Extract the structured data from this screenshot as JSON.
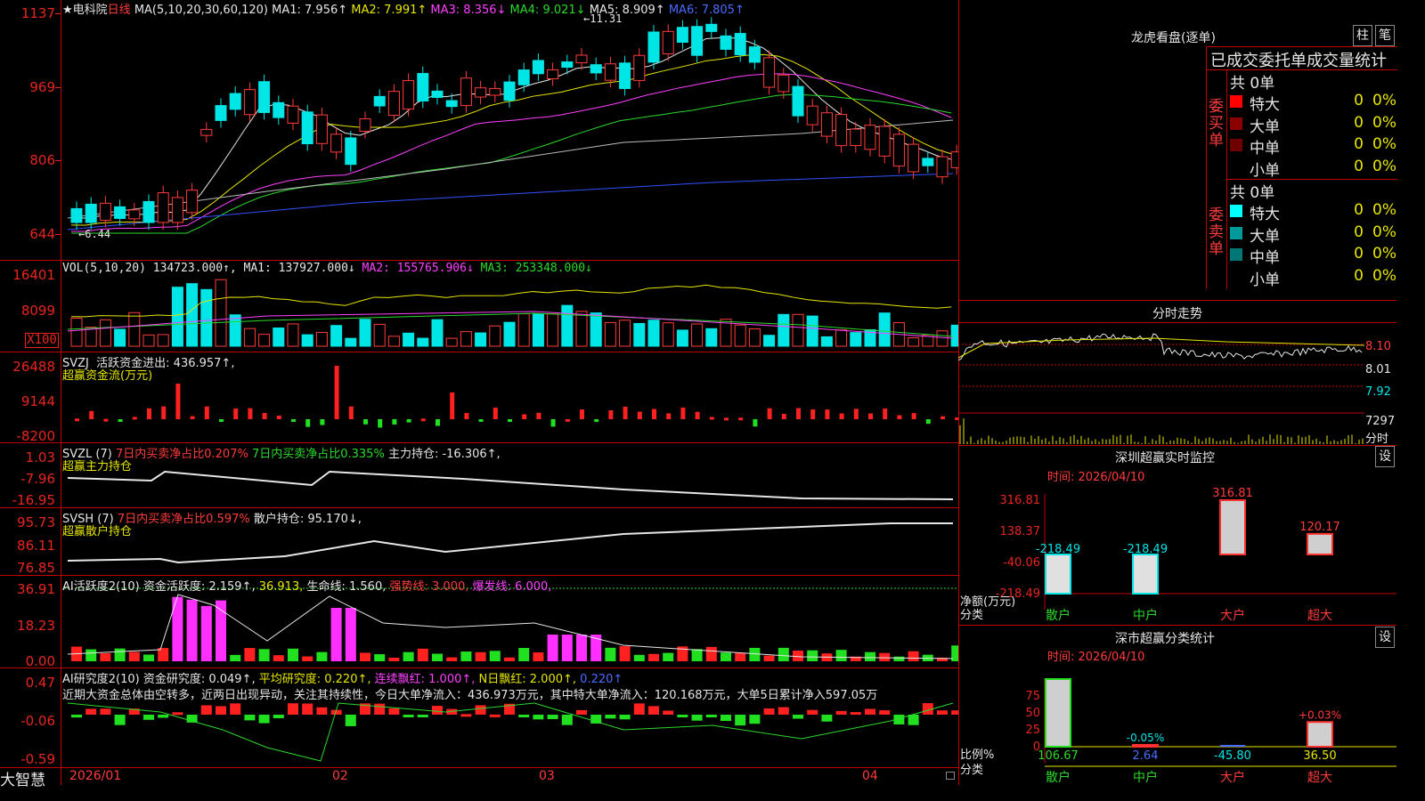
{
  "stock": {
    "name_label": "★电科院",
    "period": "日线",
    "ma_params": "MA(5,10,20,30,60,120)",
    "ma": [
      {
        "label": "MA1:",
        "value": "7.956↑",
        "color": "#e6e6e6"
      },
      {
        "label": "MA2:",
        "value": "7.991↑",
        "color": "#e6e600"
      },
      {
        "label": "MA3:",
        "value": "8.356↓",
        "color": "#ff40ff"
      },
      {
        "label": "MA4:",
        "value": "9.021↓",
        "color": "#2bd92b"
      },
      {
        "label": "MA5:",
        "value": "8.909↑",
        "color": "#e6e6e6"
      },
      {
        "label": "MA6:",
        "value": "7.805↑",
        "color": "#4a6bff"
      }
    ],
    "high_mark": "11.31",
    "low_mark": "6.44",
    "price_axis": [
      "1137",
      "969",
      "806",
      "644"
    ]
  },
  "vol": {
    "title": "VOL(5,10,20)",
    "value": "134723.000↑,",
    "ma": [
      {
        "label": "MA1:",
        "value": "137927.000↓",
        "color": "#e6e6e6"
      },
      {
        "label": "MA2:",
        "value": "155765.906↓",
        "color": "#ff40ff"
      },
      {
        "label": "MA3:",
        "value": "253348.000↓",
        "color": "#2bd92b"
      }
    ],
    "axis": [
      "16401",
      "8099"
    ],
    "unit": "X100"
  },
  "svzj": {
    "title": "SVZJ",
    "line1": "活跃资金进出: 436.957↑,",
    "line2": "超赢资金流(万元)",
    "axis": [
      "26488",
      "9144",
      "-8200"
    ]
  },
  "svzl": {
    "title": "SVZL (7)",
    "a": "7日内买卖净占比0.207%",
    "b": "7日内买卖净占比0.335%",
    "c": "主力持仓: -16.306↑,",
    "line2": "超赢主力持仓",
    "axis": [
      "1.03",
      "-7.96",
      "-16.95"
    ]
  },
  "svsh": {
    "title": "SVSH (7)",
    "a": "7日内买卖净占比0.597%",
    "c": "散户持仓: 95.170↓,",
    "line2": "超赢散户持仓",
    "axis": [
      "95.73",
      "86.11",
      "76.85"
    ]
  },
  "ai_active": {
    "title": "AI活跃度2(10)",
    "a": "资金活跃度: 2.159↑,",
    "b": "36.913,",
    "c": "生命线: 1.560,",
    "d": "强势线: 3.000,",
    "e": "爆发线: 6.000,",
    "axis": [
      "36.91",
      "18.23",
      "0.00"
    ]
  },
  "ai_research": {
    "title": "AI研究度2(10)",
    "a": "资金研究度: 0.049↑,",
    "b": "平均研究度: 0.220↑,",
    "c": "连续飘红: 1.000↑,",
    "d": "N日飘红: 2.000↑,",
    "e": "0.220↑",
    "comment": "近期大资金总体由空转多，近两日出现异动，关注其持续性，今日大单净流入：436.973万元，其中特大单净流入：120.168万元，大单5日累计净入597.05万",
    "axis": [
      "0.47",
      "-0.06",
      "-0.59"
    ]
  },
  "date_axis": {
    "brand": "大智慧",
    "labels": [
      "2026/01",
      "02",
      "03",
      "04"
    ]
  },
  "right": {
    "lhb_title": "龙虎看盘(逐单)",
    "btn_zhu": "柱",
    "btn_bi": "笔",
    "stats_title": "已成交委托单成交量统计",
    "buy": {
      "side": "委买单",
      "total": "共 0单",
      "rows": [
        {
          "name": "特大",
          "color": "#ff0000",
          "v1": "0",
          "v2": "0%"
        },
        {
          "name": "大单",
          "color": "#8b0000",
          "v1": "0",
          "v2": "0%"
        },
        {
          "name": "中单",
          "color": "#6e0000",
          "v1": "0",
          "v2": "0%"
        },
        {
          "name": "小单",
          "color": "#000000",
          "v1": "0",
          "v2": "0%"
        }
      ]
    },
    "sell": {
      "side": "委卖单",
      "total": "共 0单",
      "rows": [
        {
          "name": "特大",
          "color": "#00ffff",
          "v1": "0",
          "v2": "0%"
        },
        {
          "name": "大单",
          "color": "#009a9a",
          "v1": "0",
          "v2": "0%"
        },
        {
          "name": "中单",
          "color": "#007777",
          "v1": "0",
          "v2": "0%"
        },
        {
          "name": "小单",
          "color": "#000000",
          "v1": "0",
          "v2": "0%"
        }
      ]
    },
    "intraday": {
      "title": "分时走势",
      "axis": [
        "8.10",
        "8.01",
        "7.92"
      ],
      "vol": "7297",
      "vol_unit": "分时"
    },
    "monitor": {
      "title": "深圳超赢实时监控",
      "btn": "设",
      "time": "时间: 2026/04/10",
      "axis": [
        "316.81",
        "138.37",
        "-40.06",
        "-218.49"
      ],
      "ylab": "净额(万元)",
      "xlab": "分类",
      "bars": [
        {
          "cat": "散户",
          "value": -218.49,
          "label": "-218.49"
        },
        {
          "cat": "中户",
          "value": -218.49,
          "label": "-218.49"
        },
        {
          "cat": "大户",
          "value": 316.81,
          "label": "316.81"
        },
        {
          "cat": "超大",
          "value": 120.17,
          "label": "120.17"
        }
      ]
    },
    "sz_stats": {
      "title": "深市超赢分类统计",
      "btn": "设",
      "time": "时间: 2026/04/10",
      "axis": [
        "75",
        "50",
        "25",
        "0"
      ],
      "ylab": "比例%",
      "xlab": "分类",
      "bars": [
        {
          "cat": "散户",
          "pct": 106.67,
          "label": "106.67"
        },
        {
          "cat": "中户",
          "pct": 2.64,
          "label": "2.64",
          "tag": "-0.05%"
        },
        {
          "cat": "大户",
          "pct": -45.8,
          "label": "-45.80"
        },
        {
          "cat": "超大",
          "pct": 36.5,
          "label": "36.50",
          "tag": "+0.03%"
        }
      ]
    }
  },
  "colors": {
    "up": "#ff3b3b",
    "down": "#00e6e6",
    "grid": "#c00000"
  }
}
